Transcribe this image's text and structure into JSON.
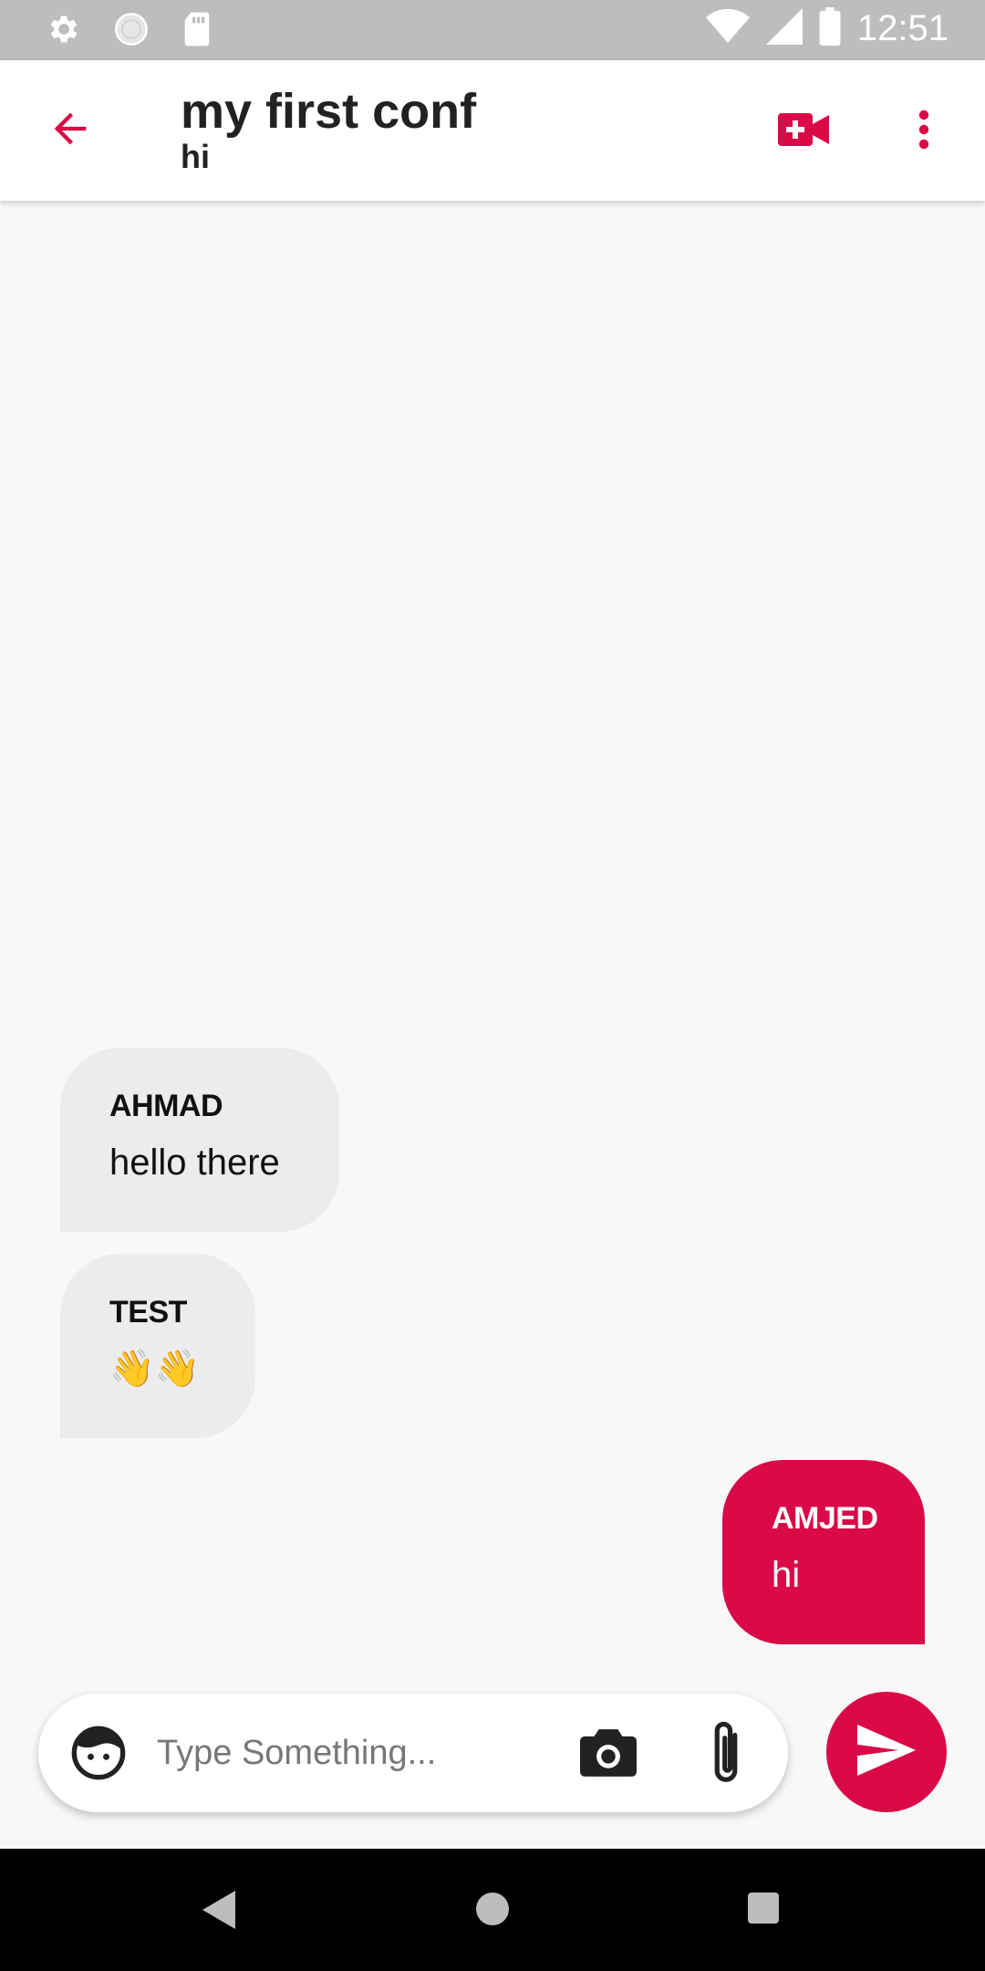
{
  "status_bar": {
    "time": "12:51",
    "icons": [
      "gear-icon",
      "circle-icon",
      "sd-card-icon",
      "wifi-icon",
      "signal-icon",
      "battery-icon"
    ]
  },
  "header": {
    "title": "my first conf",
    "subtitle": "hi",
    "icons": [
      "back-arrow-icon",
      "video-call-icon",
      "more-vert-icon"
    ],
    "accent_color": "#d90a47"
  },
  "messages": [
    {
      "sender": "AHMAD",
      "text": "hello there",
      "direction": "incoming"
    },
    {
      "sender": "TEST",
      "text": "👋👋",
      "direction": "incoming"
    },
    {
      "sender": "AMJED",
      "text": "hi",
      "direction": "outgoing"
    }
  ],
  "composer": {
    "placeholder": "Type Something...",
    "icons": [
      "emoji-face-icon",
      "camera-icon",
      "attach-icon",
      "send-icon"
    ]
  },
  "nav_bar": {
    "icons": [
      "nav-back-icon",
      "nav-home-icon",
      "nav-recents-icon"
    ]
  }
}
